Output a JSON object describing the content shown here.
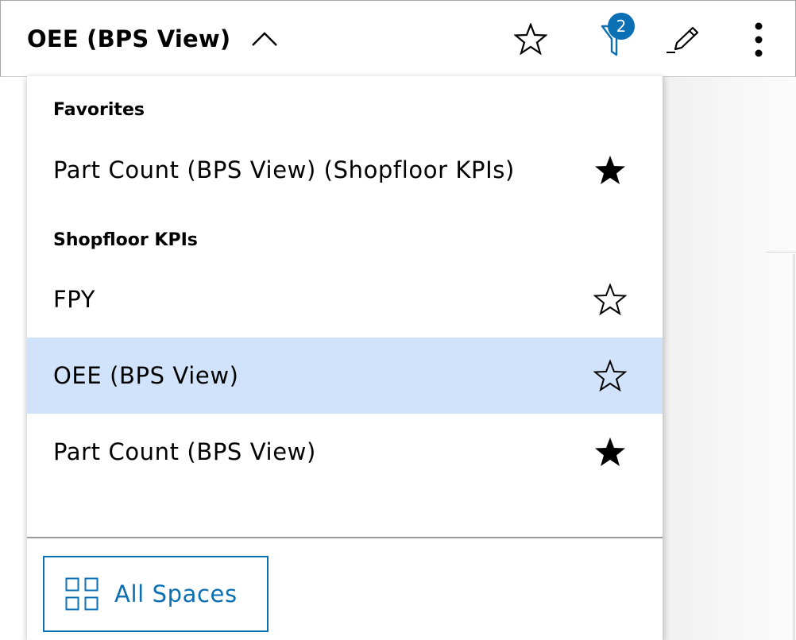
{
  "header": {
    "title": "OEE (BPS View)",
    "filter_badge_count": "2",
    "icons": [
      "chevron-up-icon",
      "star-outline-icon",
      "filter-icon",
      "pencil-icon",
      "more-vertical-icon"
    ]
  },
  "dropdown": {
    "favorites": {
      "heading": "Favorites",
      "items": [
        {
          "label": "Part Count (BPS View) (Shopfloor KPIs)",
          "favorite": true
        }
      ]
    },
    "shopfloor": {
      "heading": "Shopfloor KPIs",
      "items": [
        {
          "label": "FPY",
          "favorite": false,
          "selected": false
        },
        {
          "label": "OEE (BPS View)",
          "favorite": false,
          "selected": true
        },
        {
          "label": "Part Count (BPS View)",
          "favorite": true,
          "selected": false
        }
      ]
    },
    "all_spaces_label": "All Spaces"
  },
  "colors": {
    "accent": "#0b6fb4",
    "selected_row": "#d1e3fa",
    "text": "#000000"
  }
}
